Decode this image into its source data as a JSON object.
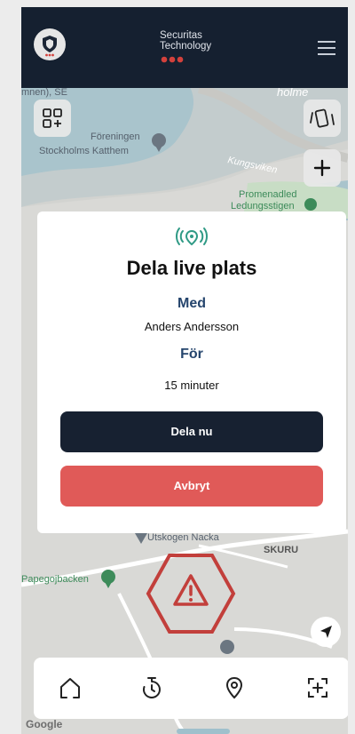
{
  "header": {
    "brand_line1": "Securitas",
    "brand_line2": "Technology"
  },
  "map_labels": {
    "area_se": "mnen), SE",
    "holme": "holme",
    "foreningen": "Föreningen",
    "katthem": "Stockholms Katthem",
    "kungsviken": "Kungsviken",
    "promenadled": "Promenadled",
    "ledungsstigen": "Ledungsstigen",
    "skuru": "SKURU",
    "papegojbacken": "Papegojbacken",
    "utskogen_nacka": "Utskogen Nacka",
    "google": "Google"
  },
  "modal": {
    "title": "Dela live plats",
    "with_label": "Med",
    "with_value": "Anders Andersson",
    "for_label": "För",
    "for_value": "15 minuter",
    "share_button": "Dela nu",
    "cancel_button": "Avbryt"
  },
  "colors": {
    "header_bg": "#152030",
    "accent_teal": "#2f9a85",
    "label_blue": "#25456d",
    "primary_button": "#172131",
    "cancel_button": "#e05a58",
    "alert_red": "#c23f3b"
  },
  "icons": {
    "header": [
      "logo-shield-icon",
      "menu-icon"
    ],
    "map": [
      "qr-code-icon",
      "vibrate-icon",
      "plus-icon",
      "navigation-arrow-icon",
      "alert-hexagon-icon"
    ],
    "modal": "live-location-icon",
    "nav": [
      "home-icon",
      "timer-icon",
      "location-icon",
      "scan-icon"
    ]
  }
}
